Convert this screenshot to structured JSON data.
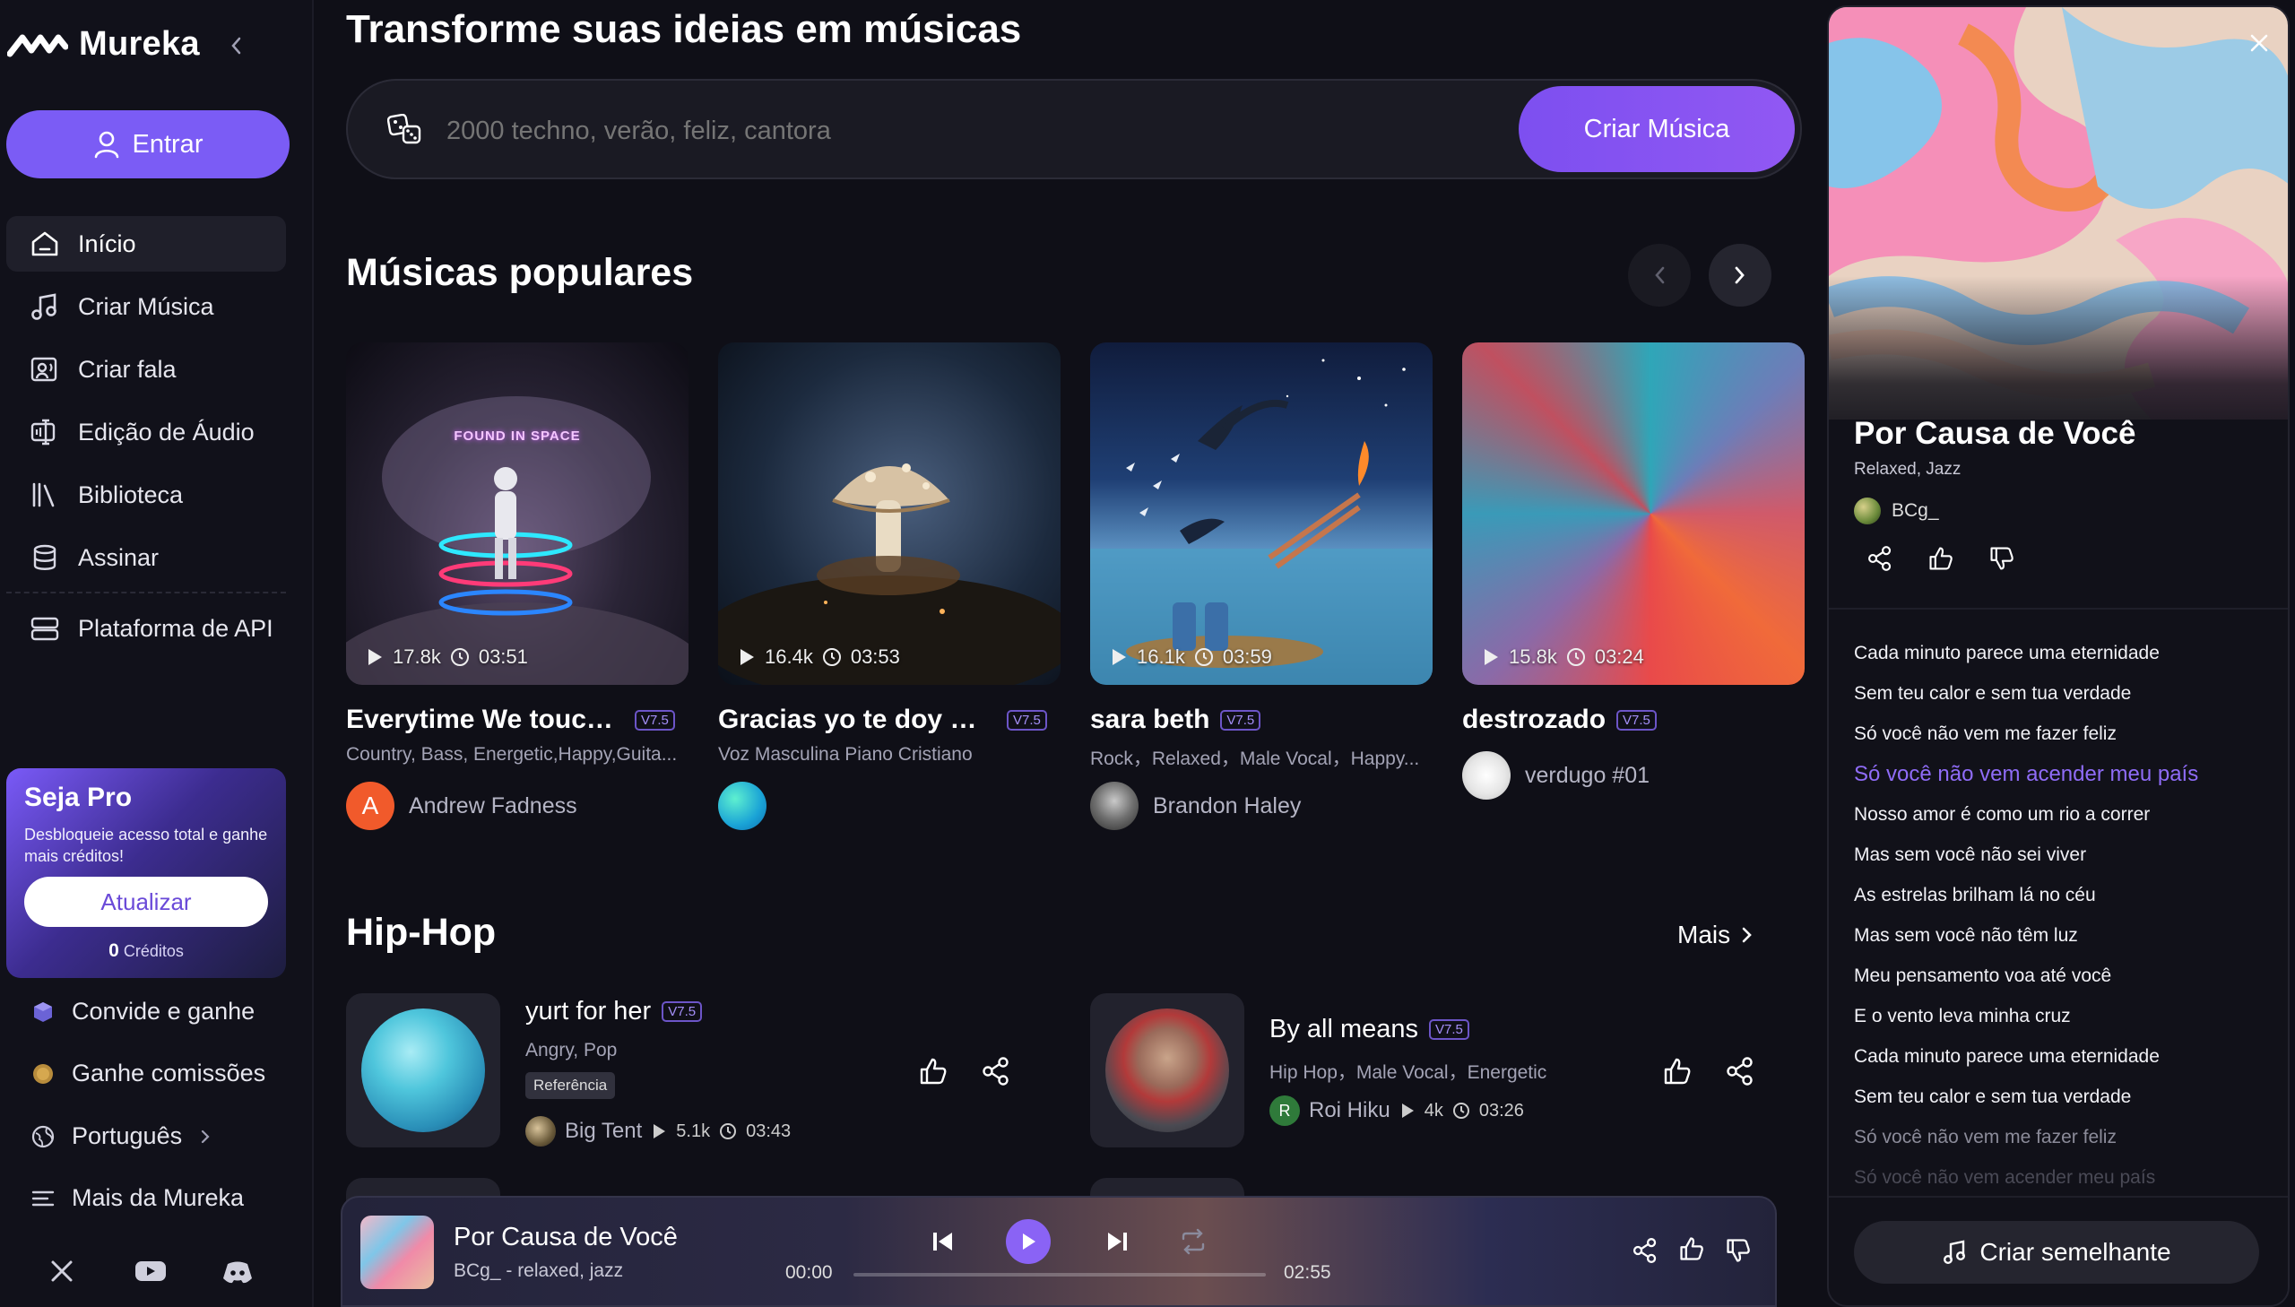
{
  "sidebar": {
    "logo": "Mureka",
    "enter_label": "Entrar",
    "nav": [
      {
        "label": "Início",
        "icon": "home-icon"
      },
      {
        "label": "Criar Música",
        "icon": "music-note-icon"
      },
      {
        "label": "Criar fala",
        "icon": "speech-icon"
      },
      {
        "label": "Edição de Áudio",
        "icon": "audio-edit-icon"
      },
      {
        "label": "Biblioteca",
        "icon": "library-icon"
      },
      {
        "label": "Assinar",
        "icon": "database-icon"
      },
      {
        "label": "Plataforma de API",
        "icon": "api-icon"
      }
    ],
    "pro": {
      "title": "Seja Pro",
      "desc": "Desbloqueie acesso total e ganhe mais créditos!",
      "upgrade": "Atualizar",
      "credits_value": "0",
      "credits_label": "Créditos"
    },
    "links": {
      "invite": "Convide e ganhe",
      "commission": "Ganhe comissões",
      "language": "Português",
      "more": "Mais da Mureka"
    },
    "social": [
      "x-icon",
      "youtube-icon",
      "discord-icon"
    ]
  },
  "main": {
    "hero_title": "Transforme suas ideias em músicas",
    "prompt_placeholder": "2000 techno, verão, feliz, cantora",
    "create_label": "Criar Música",
    "popular_title": "Músicas populares",
    "popular": [
      {
        "title": "Everytime We touch c...",
        "version": "V7.5",
        "tags": "Country, Bass, Energetic,Happy,Guita...",
        "plays": "17.8k",
        "duration": "03:51",
        "author": "Andrew Fadness",
        "avatar_letter": "A",
        "cover_text": "FOUND IN SPACE"
      },
      {
        "title": "Gracias yo te doy mi C...",
        "version": "V7.5",
        "tags": "Voz Masculina Piano Cristiano",
        "plays": "16.4k",
        "duration": "03:53",
        "author": ""
      },
      {
        "title": "sara beth",
        "version": "V7.5",
        "tags": "Rock，Relaxed，Male Vocal，Happy...",
        "plays": "16.1k",
        "duration": "03:59",
        "author": "Brandon Haley"
      },
      {
        "title": "destrozado",
        "version": "V7.5",
        "tags": "",
        "plays": "15.8k",
        "duration": "03:24",
        "author": "verdugo #01"
      }
    ],
    "hiphop_title": "Hip-Hop",
    "more_label": "Mais",
    "hiphop": [
      {
        "title": "yurt for her",
        "version": "V7.5",
        "tags": "Angry, Pop",
        "badge": "Referência",
        "author": "Big Tent",
        "plays": "5.1k",
        "duration": "03:43"
      },
      {
        "title": "By all means",
        "version": "V7.5",
        "tags": "Hip Hop，Male Vocal，Energetic",
        "author": "Roi Hiku",
        "avatar_letter": "R",
        "plays": "4k",
        "duration": "03:26"
      }
    ]
  },
  "player": {
    "title": "Por Causa de Você",
    "subtitle": "BCg_ - relaxed, jazz",
    "current": "00:00",
    "total": "02:55",
    "progress": 0
  },
  "panel": {
    "title": "Por Causa de Você",
    "tags": "Relaxed, Jazz",
    "author": "BCg_",
    "lyrics": [
      "Cada minuto parece uma eternidade",
      "Sem teu calor e sem tua verdade",
      "Só você não vem me fazer feliz",
      "Só você não vem acender meu país",
      "Nosso amor é como um rio a correr",
      "Mas sem você não sei viver",
      "As estrelas brilham lá no céu",
      "Mas sem você não têm luz",
      "Meu pensamento voa até você",
      "E o vento leva minha cruz",
      "Cada minuto parece uma eternidade",
      "Sem teu calor e sem tua verdade",
      "Só você não vem me fazer feliz",
      "Só você não vem acender meu país"
    ],
    "current_lyric_index": 3,
    "similar_label": "Criar semelhante"
  },
  "colors": {
    "accent": "#7b5cf5",
    "background": "#0f0f17",
    "highlight_lyric": "#8f6cf7"
  }
}
